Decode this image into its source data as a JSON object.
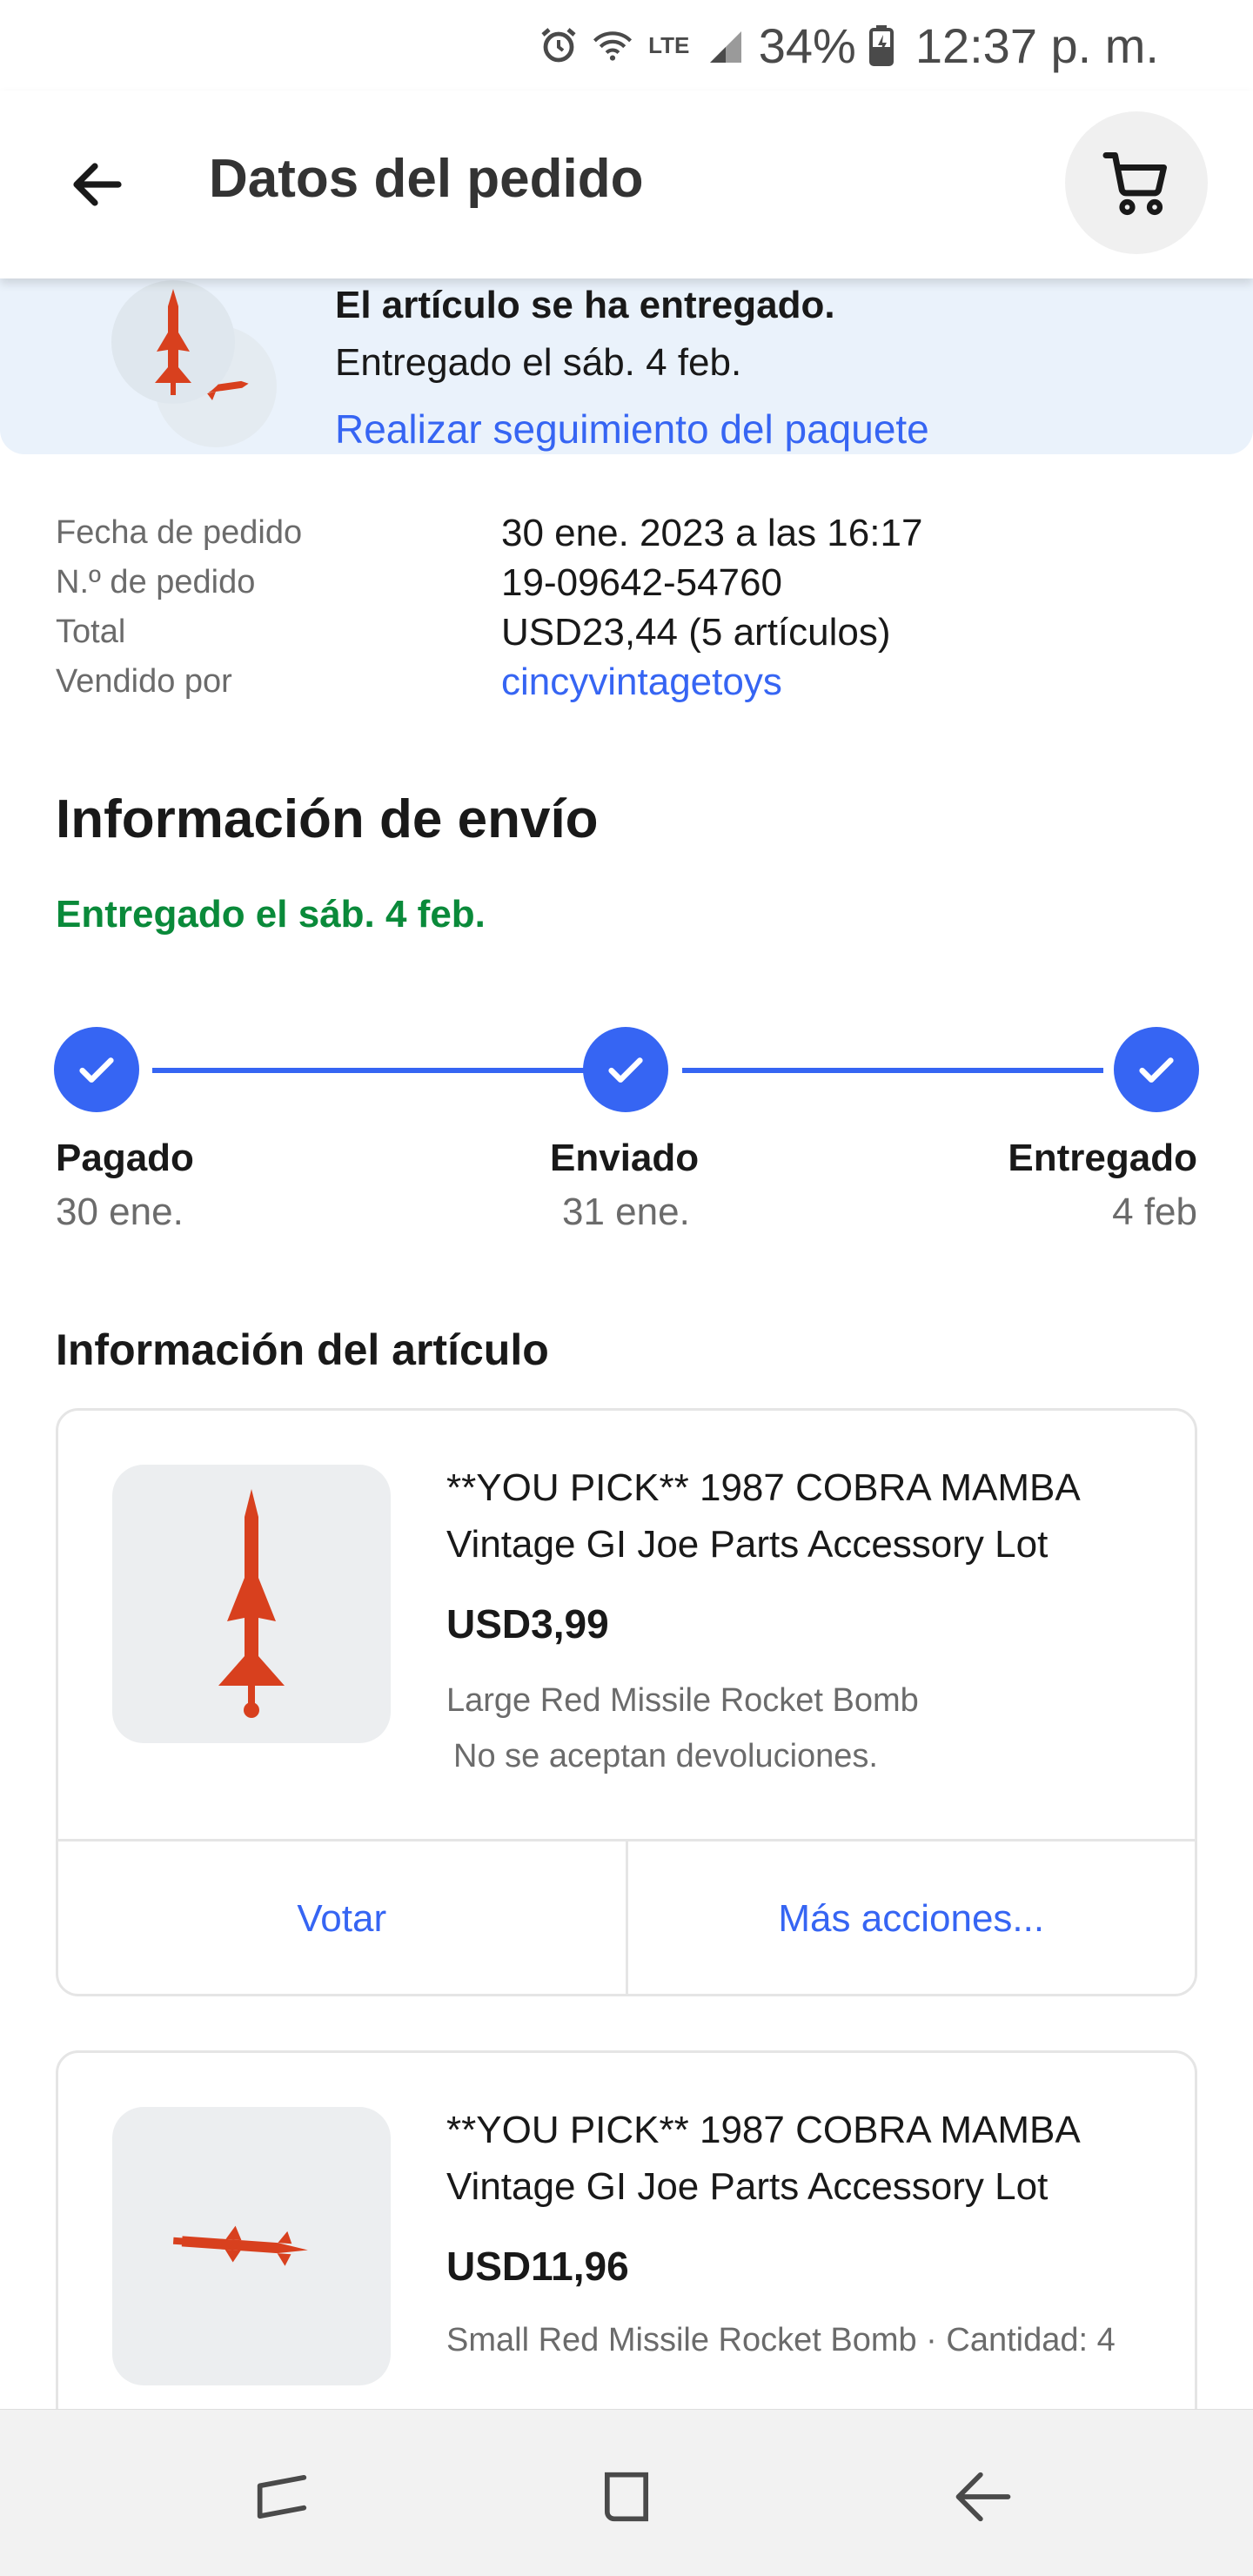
{
  "status_bar": {
    "battery": "34%",
    "time": "12:37 p. m.",
    "network_label": "LTE",
    "icons": [
      "alarm-icon",
      "wifi-icon",
      "lte-icon",
      "signal-icon",
      "battery-icon"
    ]
  },
  "header": {
    "title": "Datos del pedido",
    "back_icon": "arrow-left-icon",
    "cart_icon": "cart-icon"
  },
  "banner": {
    "title": "El artículo se ha entregado.",
    "date": "Entregado el sáb. 4 feb.",
    "track_link": "Realizar seguimiento del paquete"
  },
  "order": {
    "rows": [
      {
        "label": "Fecha de pedido",
        "value": "30 ene. 2023 a las 16:17"
      },
      {
        "label": "N.º de pedido",
        "value": "19-09642-54760"
      },
      {
        "label": "Total",
        "value": "USD23,44 (5 artículos)"
      },
      {
        "label": "Vendido por",
        "value": "cincyvintagetoys"
      }
    ]
  },
  "shipping": {
    "title": "Información de envío",
    "status": "Entregado el sáb. 4 feb.",
    "accent": "#3665f3",
    "steps": [
      {
        "label": "Pagado",
        "date": "30 ene.",
        "done": true
      },
      {
        "label": "Enviado",
        "date": "31 ene.",
        "done": true
      },
      {
        "label": "Entregado",
        "date": "4 feb",
        "done": true
      }
    ]
  },
  "items": {
    "title": "Información del artículo",
    "list": [
      {
        "name": "**YOU PICK** 1987 COBRA MAMBA Vintage GI Joe Parts Accessory Lot",
        "price": "USD3,99",
        "variant": "Large Red Missile Rocket Bomb",
        "policy": "No se aceptan devoluciones.",
        "actions": [
          "Votar",
          "Más acciones..."
        ]
      },
      {
        "name": "**YOU PICK** 1987 COBRA MAMBA Vintage GI Joe Parts Accessory Lot",
        "price": "USD11,96",
        "variant": "Small Red Missile Rocket Bomb · Cantidad: 4"
      }
    ]
  },
  "nav": {
    "icons": [
      "recent-apps-icon",
      "home-icon",
      "back-icon"
    ]
  },
  "colors": {
    "link": "#3665f3",
    "success": "#0a8a3a",
    "banner_bg": "#eaf2fb",
    "missile": "#d8401e"
  }
}
